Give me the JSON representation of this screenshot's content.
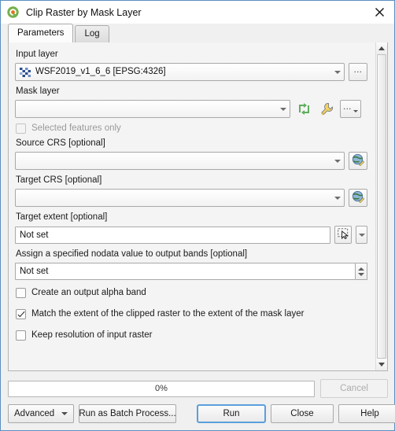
{
  "window": {
    "title": "Clip Raster by Mask Layer",
    "logo_icon": "qgis-logo-icon",
    "close_icon": "close-icon"
  },
  "tabs": [
    {
      "label": "Parameters",
      "active": true
    },
    {
      "label": "Log",
      "active": false
    }
  ],
  "parameters": {
    "input_layer": {
      "label": "Input layer",
      "value": "WSF2019_v1_6_6 [EPSG:4326]",
      "layer_icon": "raster-layer-icon",
      "browse_label": "...",
      "dropdown_icon": "chevron-down-icon"
    },
    "mask_layer": {
      "label": "Mask layer",
      "value": "",
      "dropdown_icon": "chevron-down-icon",
      "iterate_icon": "iterate-over-features-icon",
      "advanced_icon": "wrench-icon",
      "browse_label": "...",
      "browse_icon": "chevron-down-icon"
    },
    "selected_features_only": {
      "label": "Selected features only",
      "checked": false,
      "enabled": false
    },
    "source_crs": {
      "label": "Source CRS [optional]",
      "value": "",
      "dropdown_icon": "chevron-down-icon",
      "crs_icon": "crs-globe-icon"
    },
    "target_crs": {
      "label": "Target CRS [optional]",
      "value": "",
      "dropdown_icon": "chevron-down-icon",
      "crs_icon": "crs-globe-icon"
    },
    "target_extent": {
      "label": "Target extent [optional]",
      "value": "Not set",
      "extent_icon": "select-extent-on-canvas-icon",
      "dropdown_icon": "chevron-down-icon"
    },
    "nodata_value": {
      "label": "Assign a specified nodata value to output bands [optional]",
      "value": "Not set",
      "spin_up_icon": "spin-up-icon",
      "spin_down_icon": "spin-down-icon"
    },
    "create_alpha_band": {
      "label": "Create an output alpha band",
      "checked": false,
      "enabled": true
    },
    "match_extent": {
      "label": "Match the extent of the clipped raster to the extent of the mask layer",
      "checked": true,
      "enabled": true
    },
    "keep_resolution": {
      "label": "Keep resolution of input raster",
      "checked": false,
      "enabled": true
    }
  },
  "scrollbar": {
    "up_icon": "scroll-up-icon",
    "down_icon": "scroll-down-icon"
  },
  "footer": {
    "progress_text": "0%",
    "progress_percent": 0,
    "cancel_label": "Cancel",
    "cancel_enabled": false,
    "advanced_label": "Advanced",
    "advanced_icon": "chevron-down-icon",
    "batch_label": "Run as Batch Process...",
    "run_label": "Run",
    "close_label": "Close",
    "help_label": "Help"
  },
  "colors": {
    "window_border": "#5a8fc0",
    "accent_focus": "#5aa0dc",
    "qgis_green": "#589632",
    "panel_bg": "#f0f0f0",
    "field_bg": "#ffffff"
  }
}
